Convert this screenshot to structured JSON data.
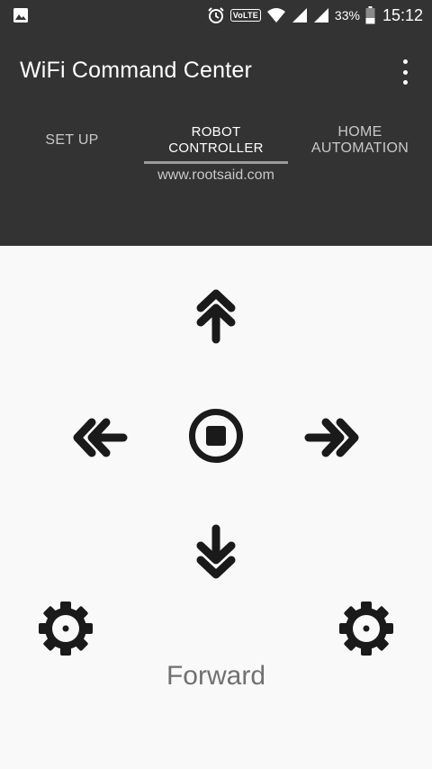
{
  "status_bar": {
    "volte": "VoLTE",
    "battery_percent": "33%",
    "time": "15:12",
    "icons": [
      "image-icon",
      "alarm-icon",
      "wifi-icon",
      "signal-icon",
      "battery-icon"
    ]
  },
  "app": {
    "title": "WiFi Command Center",
    "menu_icon": "overflow-menu-icon"
  },
  "tabs": [
    {
      "label": "SET UP",
      "active": false
    },
    {
      "label": "ROBOT\nCONTROLLER",
      "active": true
    },
    {
      "label": "HOME\nAUTOMATION",
      "active": false
    }
  ],
  "tab_subtitle": "www.rootsaid.com",
  "controls": {
    "forward": "double-arrow-up-icon",
    "left": "double-arrow-left-icon",
    "stop": "stop-icon",
    "right": "double-arrow-right-icon",
    "backward": "double-arrow-down-icon",
    "settings_left": "gear-icon",
    "settings_right": "gear-icon"
  },
  "status_text": "Forward",
  "colors": {
    "header_bg": "#333333",
    "content_bg": "#f9f9f9",
    "icon": "#1a1a1a",
    "status_text": "#707070"
  }
}
